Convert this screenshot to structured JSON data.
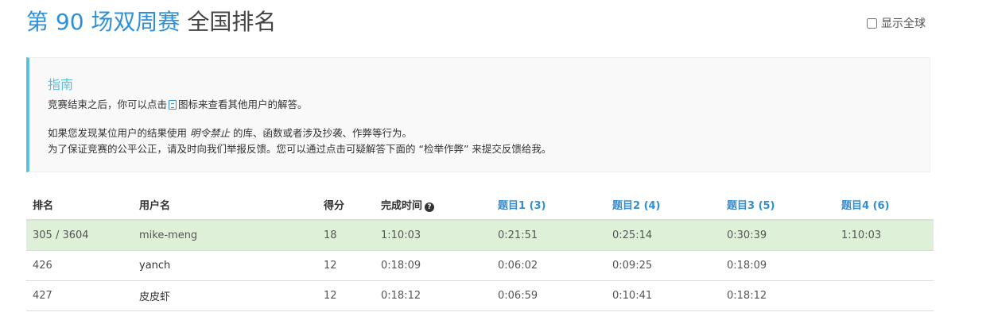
{
  "header": {
    "title_accent": "第 90 场双周赛",
    "title_rest": " 全国排名",
    "show_global_label": "显示全球"
  },
  "guide": {
    "title": "指南",
    "p1_before": "竞赛结束之后，你可以点击",
    "p1_after": "图标来查看其他用户的解答。",
    "p2_before": "如果您发现某位用户的结果使用",
    "p2_emph": "明令禁止",
    "p2_after": "的库、函数或者涉及抄袭、作弊等行为。",
    "p3": "为了保证竞赛的公平公正，请及时向我们举报反馈。您可以通过点击可疑解答下面的 “检举作弊” 来提交反馈给我。"
  },
  "table": {
    "headers": {
      "rank": "排名",
      "user": "用户名",
      "score": "得分",
      "time": "完成时间",
      "q1": "题目1 (3)",
      "q2": "题目2 (4)",
      "q3": "题目3 (5)",
      "q4": "题目4 (6)"
    },
    "rows": [
      {
        "rank": "305 / 3604",
        "user": "mike-meng",
        "score": "18",
        "time": "1:10:03",
        "q1": "0:21:51",
        "q2": "0:25:14",
        "q3": "0:30:39",
        "q4": "1:10:03"
      },
      {
        "rank": "426",
        "user": "yanch",
        "score": "12",
        "time": "0:18:09",
        "q1": "0:06:02",
        "q2": "0:09:25",
        "q3": "0:18:09",
        "q4": ""
      },
      {
        "rank": "427",
        "user": "皮皮虾",
        "score": "12",
        "time": "0:18:12",
        "q1": "0:06:59",
        "q2": "0:10:41",
        "q3": "0:18:12",
        "q4": ""
      }
    ]
  },
  "colors": {
    "accent": "#2f8fd8",
    "guide_border": "#5bc0de",
    "highlight_row": "#dff0d8"
  }
}
